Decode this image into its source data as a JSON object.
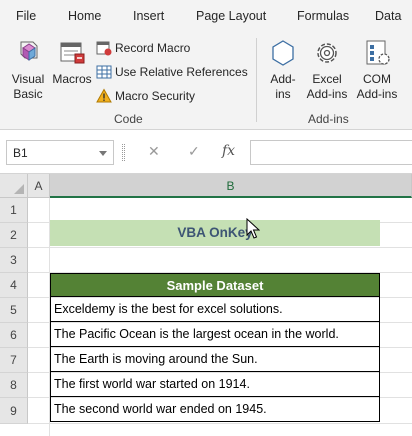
{
  "ribbon_tabs": [
    "File",
    "Home",
    "Insert",
    "Page Layout",
    "Formulas",
    "Data"
  ],
  "ribbon": {
    "visual_basic": "Visual Basic",
    "visual_basic_l1": "Visual",
    "visual_basic_l2": "Basic",
    "macros": "Macros",
    "record_macro": "Record Macro",
    "use_relative_references": "Use Relative References",
    "macro_security": "Macro Security",
    "code_group": "Code",
    "addins_l1": "Add-",
    "addins_l2": "ins",
    "excel_addins_l1": "Excel",
    "excel_addins_l2": "Add-ins",
    "com_addins_l1": "COM",
    "com_addins_l2": "Add-ins",
    "addins_group": "Add-ins"
  },
  "formula_bar": {
    "name_box": "B1",
    "cancel": "✕",
    "enter": "✓",
    "fx": "fx",
    "formula": ""
  },
  "grid": {
    "columns": [
      "A",
      "B"
    ],
    "rows": [
      "1",
      "2",
      "3",
      "4",
      "5",
      "6",
      "7",
      "8",
      "9"
    ]
  },
  "sheet": {
    "title_cell": "VBA OnKey",
    "table_header": "Sample Dataset",
    "table_rows": [
      "Exceldemy is the best for excel solutions.",
      "The Pacific Ocean is the largest ocean in the world.",
      "The Earth is moving around the Sun.",
      "The first world war started on 1914.",
      "The second world war ended on 1945."
    ]
  },
  "colors": {
    "header_fill": "#548235",
    "title_fill": "#c5e0b4",
    "title_text": "#3d5574",
    "excel_green": "#217346"
  }
}
